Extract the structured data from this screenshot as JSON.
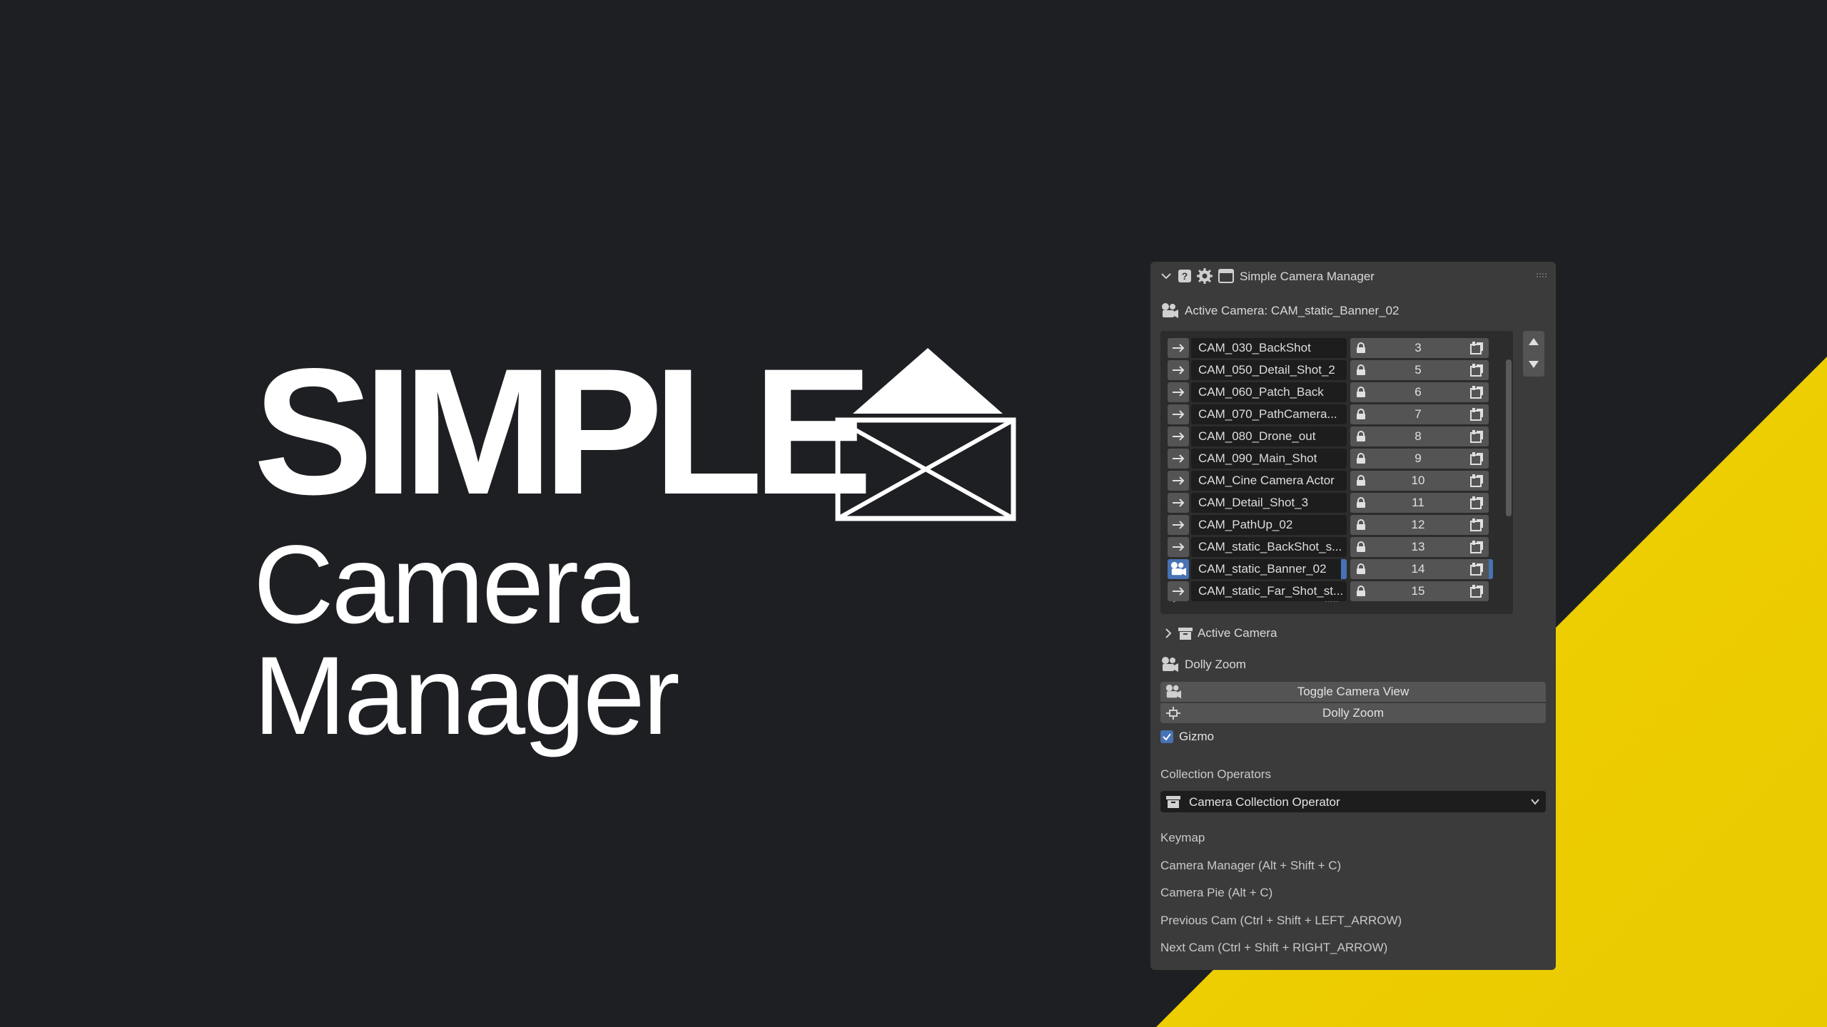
{
  "logo": {
    "line1": "SIMPLE",
    "line2": "Camera Manager"
  },
  "panel": {
    "title": "Simple Camera Manager",
    "active_camera_label": "Active Camera: CAM_static_Banner_02",
    "cameras": [
      {
        "name": "CAM_030_BackShot",
        "number": "3",
        "selected": false
      },
      {
        "name": "CAM_050_Detail_Shot_2",
        "number": "5",
        "selected": false
      },
      {
        "name": "CAM_060_Patch_Back",
        "number": "6",
        "selected": false
      },
      {
        "name": "CAM_070_PathCamera...",
        "number": "7",
        "selected": false
      },
      {
        "name": "CAM_080_Drone_out",
        "number": "8",
        "selected": false
      },
      {
        "name": "CAM_090_Main_Shot",
        "number": "9",
        "selected": false
      },
      {
        "name": "CAM_Cine Camera Actor",
        "number": "10",
        "selected": false
      },
      {
        "name": "CAM_Detail_Shot_3",
        "number": "11",
        "selected": false
      },
      {
        "name": "CAM_PathUp_02",
        "number": "12",
        "selected": false
      },
      {
        "name": "CAM_static_BackShot_s...",
        "number": "13",
        "selected": false
      },
      {
        "name": "CAM_static_Banner_02",
        "number": "14",
        "selected": true
      },
      {
        "name": "CAM_static_Far_Shot_st...",
        "number": "15",
        "selected": false
      }
    ],
    "active_camera_section": "Active Camera",
    "dolly_zoom_section": "Dolly Zoom",
    "toggle_camera_view_button": "Toggle Camera View",
    "dolly_zoom_button": "Dolly Zoom",
    "gizmo_label": "Gizmo",
    "gizmo_checked": true,
    "collection_operators_label": "Collection Operators",
    "collection_operator_select": "Camera Collection Operator",
    "keymap_label": "Keymap",
    "keymaps": [
      "Camera Manager (Alt + Shift + C)",
      "Camera Pie (Alt + C)",
      "Previous Cam (Ctrl + Shift + LEFT_ARROW)",
      "Next Cam (Ctrl + Shift + RIGHT_ARROW)"
    ]
  },
  "colors": {
    "background": "#1e1f23",
    "accent_yellow": "#f5d800",
    "panel": "#3b3b3b",
    "selection_blue": "#4772b3"
  }
}
